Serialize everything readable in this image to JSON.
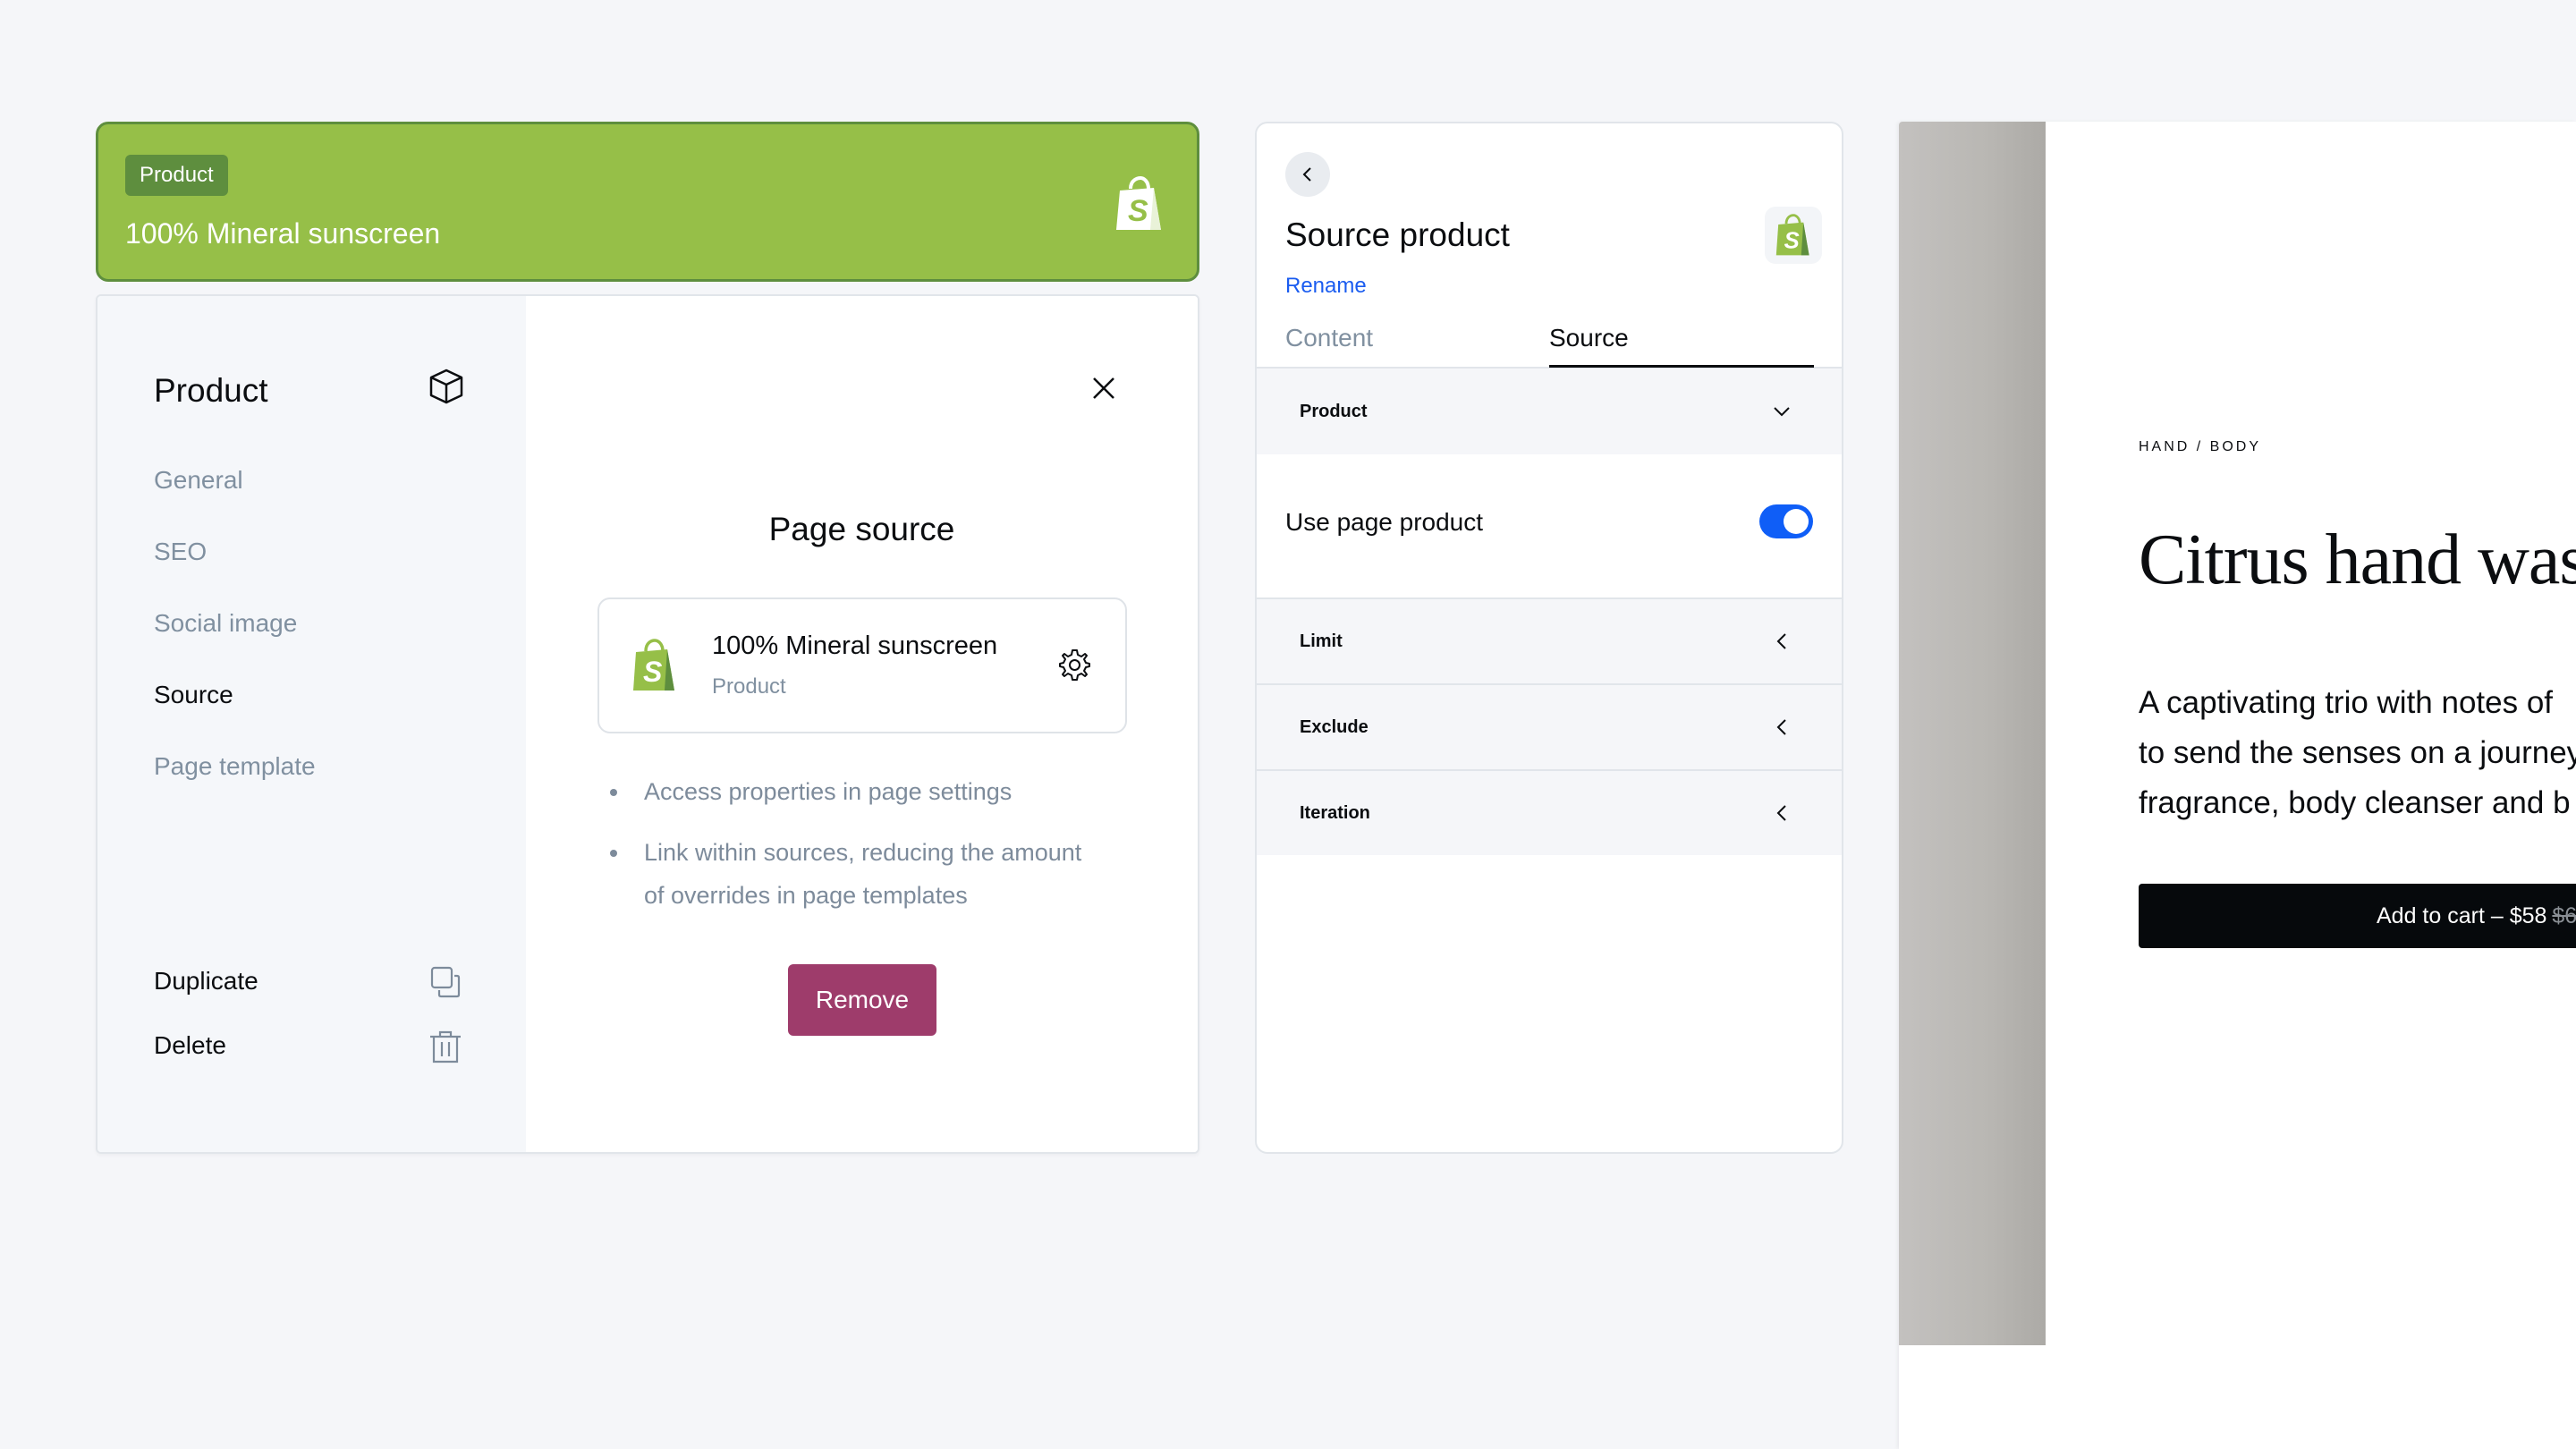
{
  "banner": {
    "badge": "Product",
    "title": "100% Mineral sunscreen",
    "icon": "shopify-bag-icon",
    "color": "#96bf48"
  },
  "settings_panel": {
    "heading": "Product",
    "heading_icon": "cube-icon",
    "nav": [
      {
        "label": "General",
        "active": false
      },
      {
        "label": "SEO",
        "active": false
      },
      {
        "label": "Social image",
        "active": false
      },
      {
        "label": "Source",
        "active": true
      },
      {
        "label": "Page template",
        "active": false
      }
    ],
    "actions": [
      {
        "label": "Duplicate",
        "icon": "duplicate-icon"
      },
      {
        "label": "Delete",
        "icon": "trash-icon"
      }
    ],
    "content": {
      "title": "Page source",
      "source_card": {
        "name": "100% Mineral sunscreen",
        "type": "Product",
        "icon": "shopify-bag-icon",
        "settings_icon": "gear-icon"
      },
      "bullets": [
        "Access properties in page settings",
        "Link within sources, reducing the amount of overrides in page templates"
      ],
      "remove_label": "Remove",
      "remove_color": "#9e3c6b"
    }
  },
  "source_panel": {
    "title": "Source product",
    "rename_label": "Rename",
    "tabs": [
      {
        "label": "Content",
        "active": false
      },
      {
        "label": "Source",
        "active": true
      }
    ],
    "product_section": "Product",
    "toggle": {
      "label": "Use page product",
      "on": true,
      "color": "#0f5ef7"
    },
    "sections": [
      "Limit",
      "Exclude",
      "Iteration"
    ]
  },
  "preview": {
    "breadcrumb": "HAND / BODY",
    "title": "Citrus hand wash",
    "description_lines": [
      "A captivating trio with notes of",
      "to send the senses on a journey",
      "fragrance, body cleanser and b"
    ],
    "cart_label": "Add to cart – $58",
    "old_price": "$6"
  }
}
